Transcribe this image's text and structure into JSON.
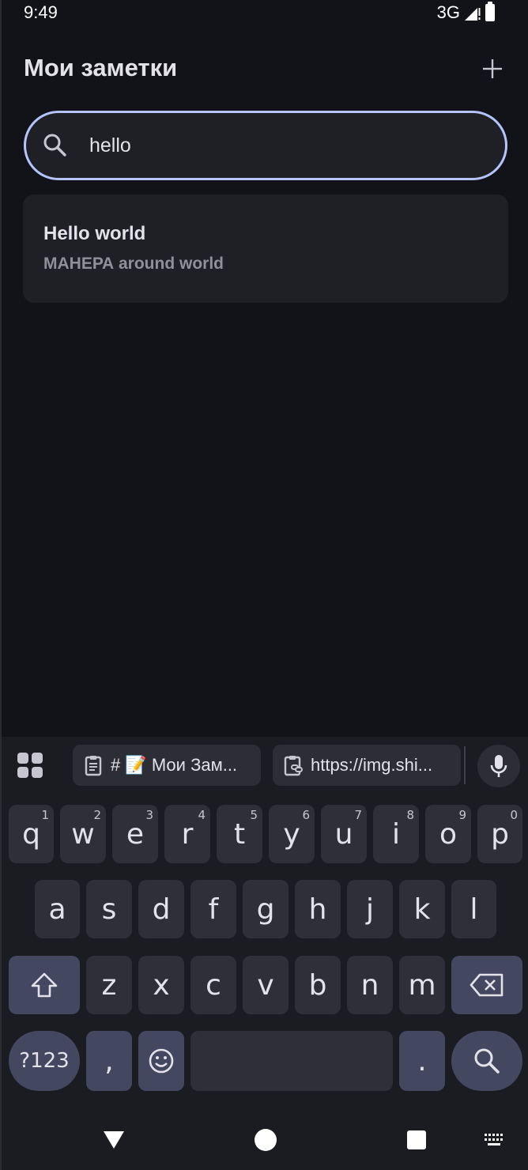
{
  "status_bar": {
    "time": "9:49",
    "network": "3G"
  },
  "header": {
    "title": "Мои заметки",
    "add_icon": "plus-icon"
  },
  "search": {
    "value": "hello",
    "icon": "search-icon"
  },
  "notes": [
    {
      "title": "Hello world",
      "preview": "МАНЕРА around world"
    }
  ],
  "keyboard": {
    "clip_chips": [
      "# 📝 Мои Зам...",
      "https://img.shi..."
    ],
    "row1": [
      {
        "label": "q",
        "hint": "1"
      },
      {
        "label": "w",
        "hint": "2"
      },
      {
        "label": "e",
        "hint": "3"
      },
      {
        "label": "r",
        "hint": "4"
      },
      {
        "label": "t",
        "hint": "5"
      },
      {
        "label": "y",
        "hint": "6"
      },
      {
        "label": "u",
        "hint": "7"
      },
      {
        "label": "i",
        "hint": "8"
      },
      {
        "label": "o",
        "hint": "9"
      },
      {
        "label": "p",
        "hint": "0"
      }
    ],
    "row2": [
      "a",
      "s",
      "d",
      "f",
      "g",
      "h",
      "j",
      "k",
      "l"
    ],
    "row3": [
      "z",
      "x",
      "c",
      "v",
      "b",
      "n",
      "m"
    ],
    "symbols_label": "?123",
    "comma_label": ",",
    "period_label": "."
  },
  "colors": {
    "background": "#121318",
    "accent": "#b5c4ff",
    "card": "#1f2026",
    "key": "#2f3037",
    "special_key": "#434860"
  }
}
